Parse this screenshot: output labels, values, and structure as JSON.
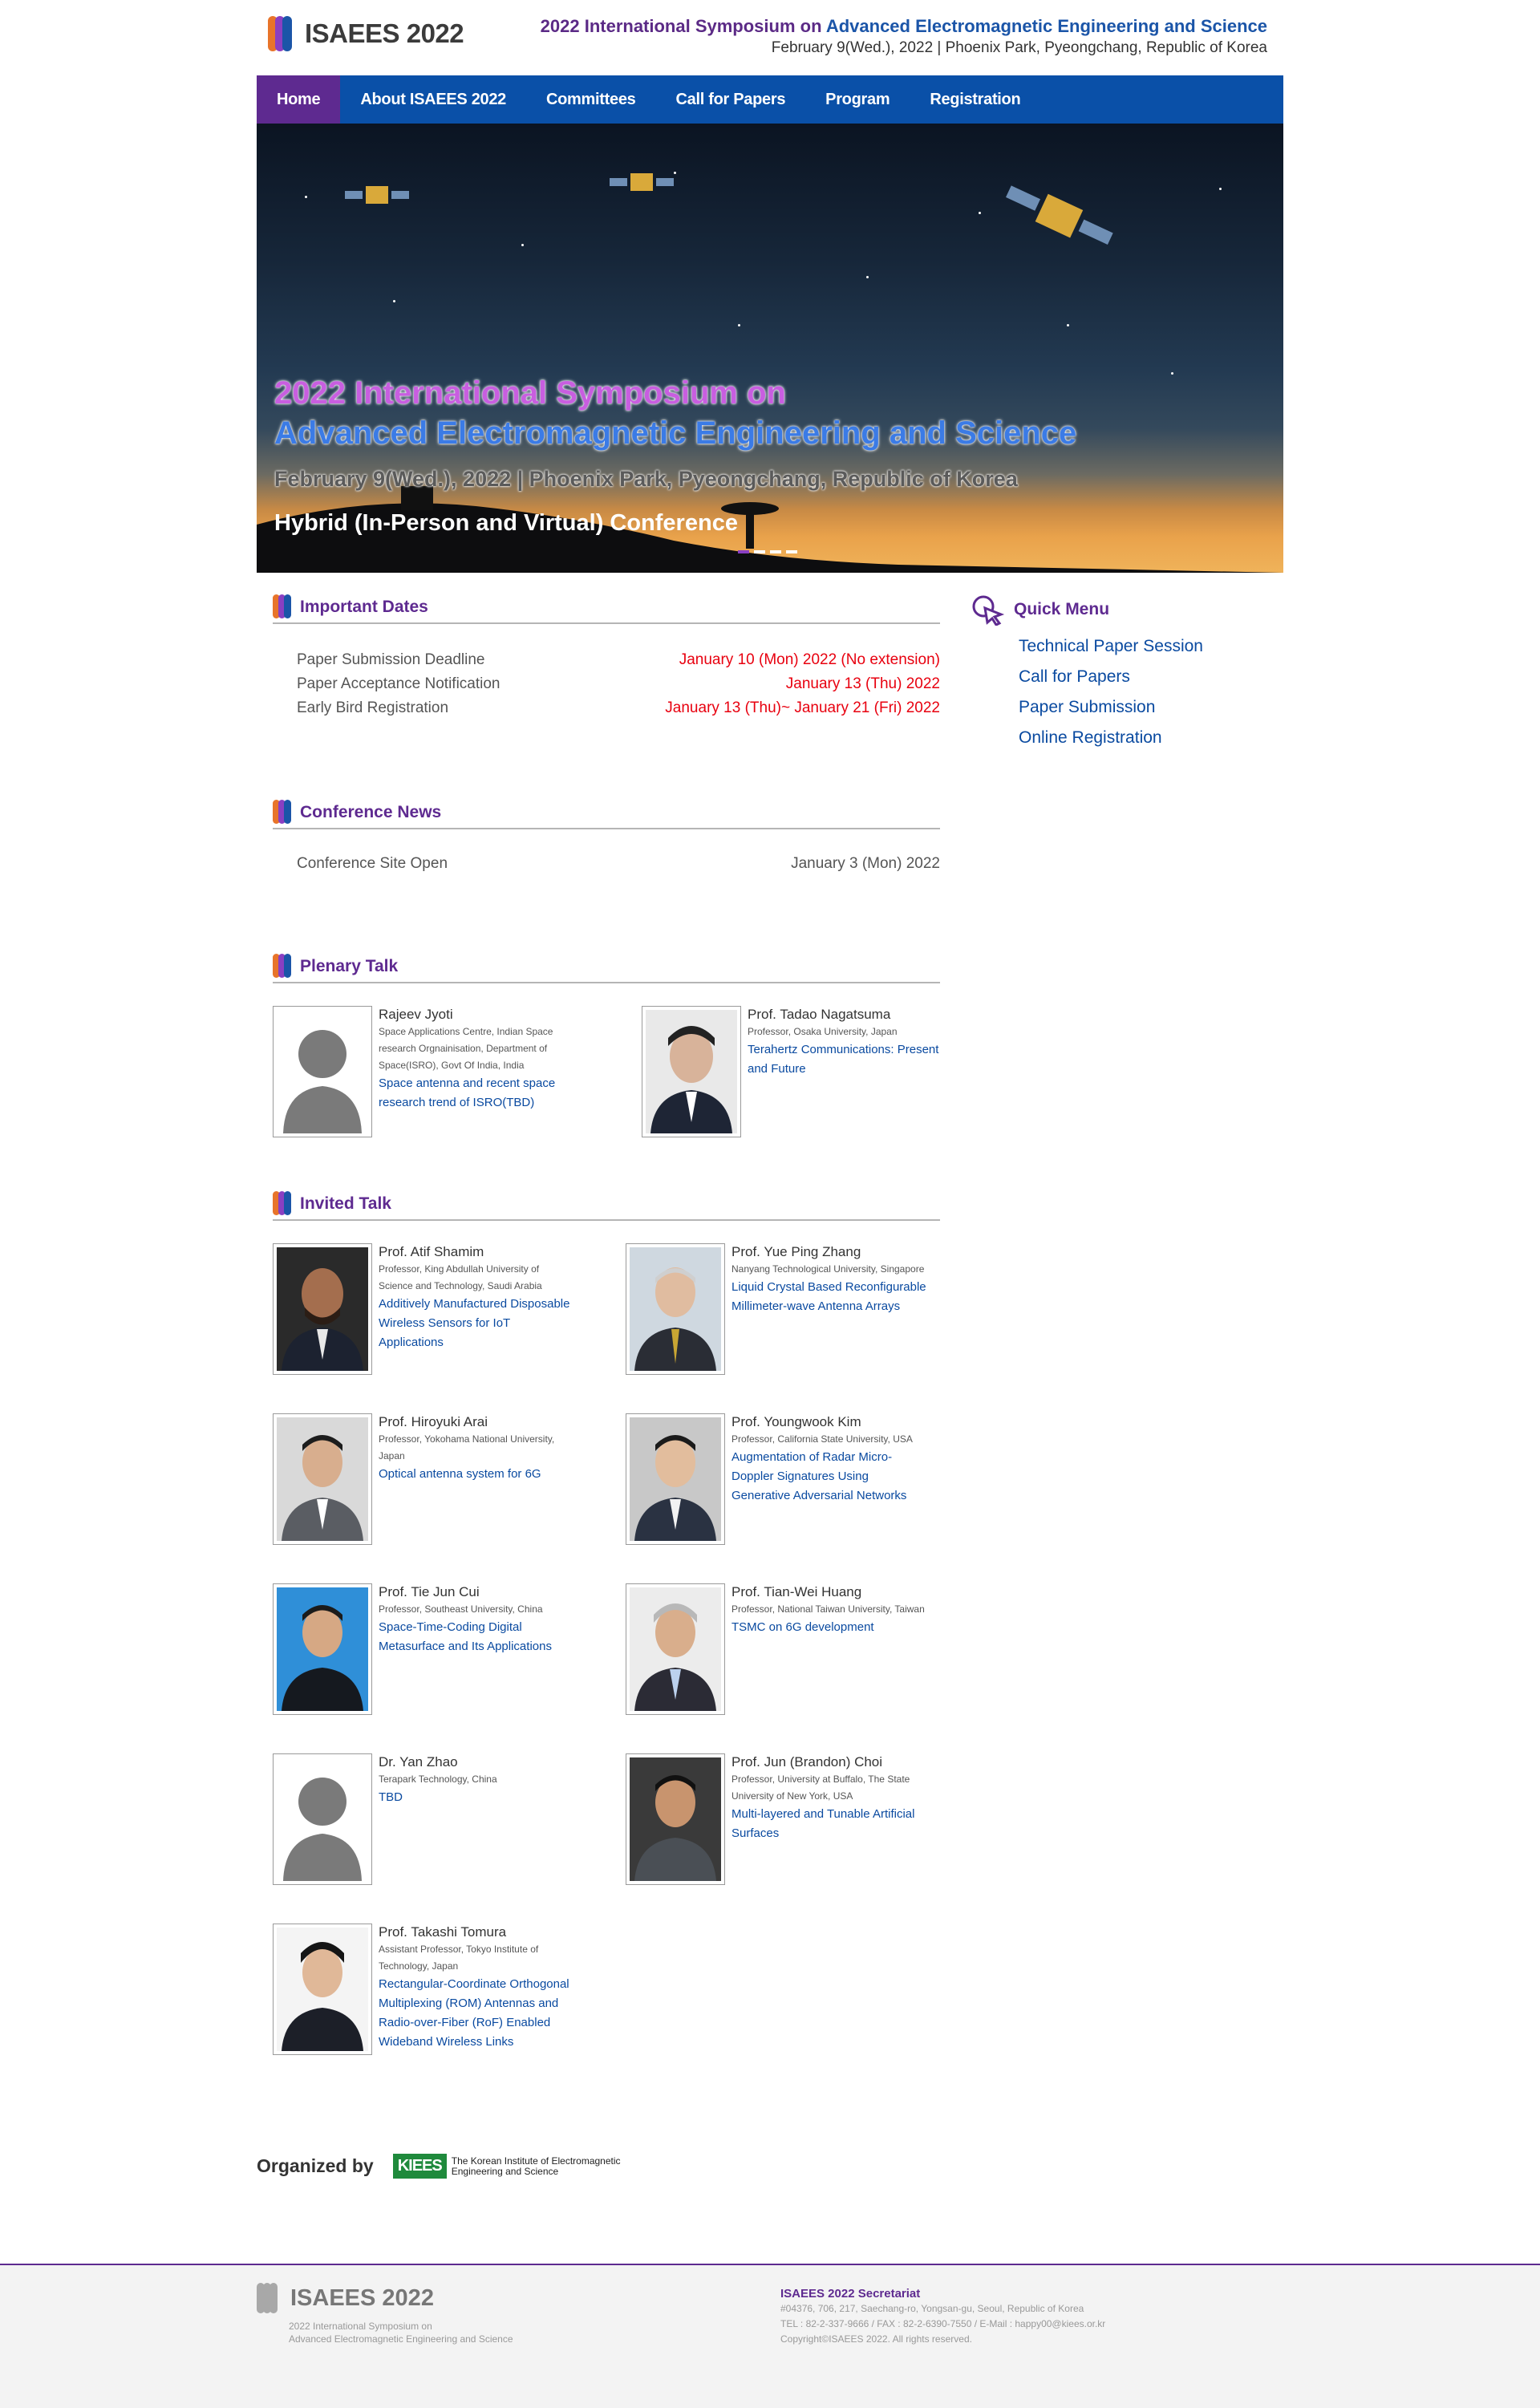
{
  "header": {
    "logo_text": "ISAEES 2022",
    "title_part1": "2022 International Symposium on",
    "title_part2": "Advanced Electromagnetic Engineering and Science",
    "subtitle": "February 9(Wed.), 2022 | Phoenix Park, Pyeongchang, Republic of Korea"
  },
  "nav": {
    "items": [
      {
        "label": "Home"
      },
      {
        "label": "About ISAEES 2022"
      },
      {
        "label": "Committees"
      },
      {
        "label": "Call for Papers"
      },
      {
        "label": "Program"
      },
      {
        "label": "Registration"
      }
    ]
  },
  "banner": {
    "line1": "2022 International Symposium on",
    "line2": "Advanced Electromagnetic Engineering and Science",
    "line3": "February 9(Wed.), 2022 | Phoenix Park, Pyeongchang, Republic of Korea",
    "line4": "Hybrid (In-Person and Virtual) Conference"
  },
  "important_dates": {
    "title": "Important Dates",
    "rows": [
      {
        "label": "Paper Submission Deadline",
        "value": "January 10 (Mon) 2022 (No extension)"
      },
      {
        "label": "Paper Acceptance Notification",
        "value": "January 13 (Thu) 2022"
      },
      {
        "label": "Early Bird Registration",
        "value": "January 13 (Thu)~ January 21 (Fri) 2022"
      }
    ]
  },
  "news": {
    "title": "Conference News",
    "rows": [
      {
        "label": "Conference Site Open",
        "value": "January 3 (Mon) 2022"
      }
    ]
  },
  "plenary": {
    "title": "Plenary Talk",
    "speakers": [
      {
        "name": "Rajeev Jyoti",
        "affiliation": "Space Applications Centre, Indian Space research Orgnainisation, Department of Space(ISRO), Govt Of India, India",
        "talk": "Space antenna and recent space research trend of ISRO(TBD)"
      },
      {
        "name": "Prof. Tadao Nagatsuma",
        "affiliation": "Professor, Osaka University, Japan",
        "talk": "Terahertz Communications: Present and Future"
      }
    ]
  },
  "invited": {
    "title": "Invited Talk",
    "speakers": [
      {
        "name": "Prof. Atif Shamim",
        "affiliation": "Professor, King Abdullah University of Science and Technology, Saudi Arabia",
        "talk": "Additively Manufactured Disposable Wireless Sensors for IoT Applications"
      },
      {
        "name": "Prof. Yue Ping Zhang",
        "affiliation": "Nanyang Technological University, Singapore",
        "talk": "Liquid Crystal Based Reconfigurable Millimeter-wave Antenna Arrays"
      },
      {
        "name": "Prof. Hiroyuki Arai",
        "affiliation": "Professor, Yokohama National University, Japan",
        "talk": "Optical antenna system for 6G"
      },
      {
        "name": "Prof. Youngwook Kim",
        "affiliation": "Professor, California State University, USA",
        "talk": "Augmentation of Radar Micro-Doppler Signatures Using Generative Adversarial Networks"
      },
      {
        "name": "Prof. Tie Jun Cui",
        "affiliation": "Professor, Southeast University, China",
        "talk": "Space-Time-Coding Digital Metasurface and Its Applications"
      },
      {
        "name": "Prof. Tian-Wei Huang",
        "affiliation": "Professor, National Taiwan University, Taiwan",
        "talk": "TSMC on 6G development"
      },
      {
        "name": "Dr. Yan Zhao",
        "affiliation": "Terapark Technology, China",
        "talk": "TBD"
      },
      {
        "name": "Prof. Jun (Brandon) Choi",
        "affiliation": "Professor, University at Buffalo, The State University of New York, USA",
        "talk": "Multi-layered and Tunable Artificial Surfaces"
      },
      {
        "name": "Prof. Takashi Tomura",
        "affiliation": "Assistant Professor, Tokyo Institute of Technology, Japan",
        "talk": "Rectangular-Coordinate Orthogonal Multiplexing (ROM) Antennas and Radio-over-Fiber (RoF) Enabled Wideband Wireless Links"
      }
    ]
  },
  "quick_menu": {
    "title": "Quick Menu",
    "items": [
      {
        "label": "Technical Paper Session"
      },
      {
        "label": "Call for Papers"
      },
      {
        "label": "Paper Submission"
      },
      {
        "label": "Online Registration"
      }
    ]
  },
  "organized": {
    "label": "Organized by",
    "org_logo": "KIEES",
    "org_name_line1": "The Korean Institute of Electromagnetic",
    "org_name_line2": "Engineering and Science"
  },
  "footer": {
    "logo_text": "ISAEES 2022",
    "sub_line1": "2022 International Symposium on",
    "sub_line2": "Advanced Electromagnetic Engineering and Science",
    "secretariat": "ISAEES 2022 Secretariat",
    "address": "#04376, 706, 217, Saechang-ro, Yongsan-gu, Seoul, Republic of Korea",
    "contact": "TEL : 82-2-337-9666 / FAX : 82-2-6390-7550 / E-Mail : happy00@kiees.or.kr",
    "copyright": "Copyright©ISAEES 2022. All rights reserved."
  },
  "colors": {
    "purple": "#5e2a90",
    "blue": "#0a50a8",
    "red": "#e8000f"
  }
}
